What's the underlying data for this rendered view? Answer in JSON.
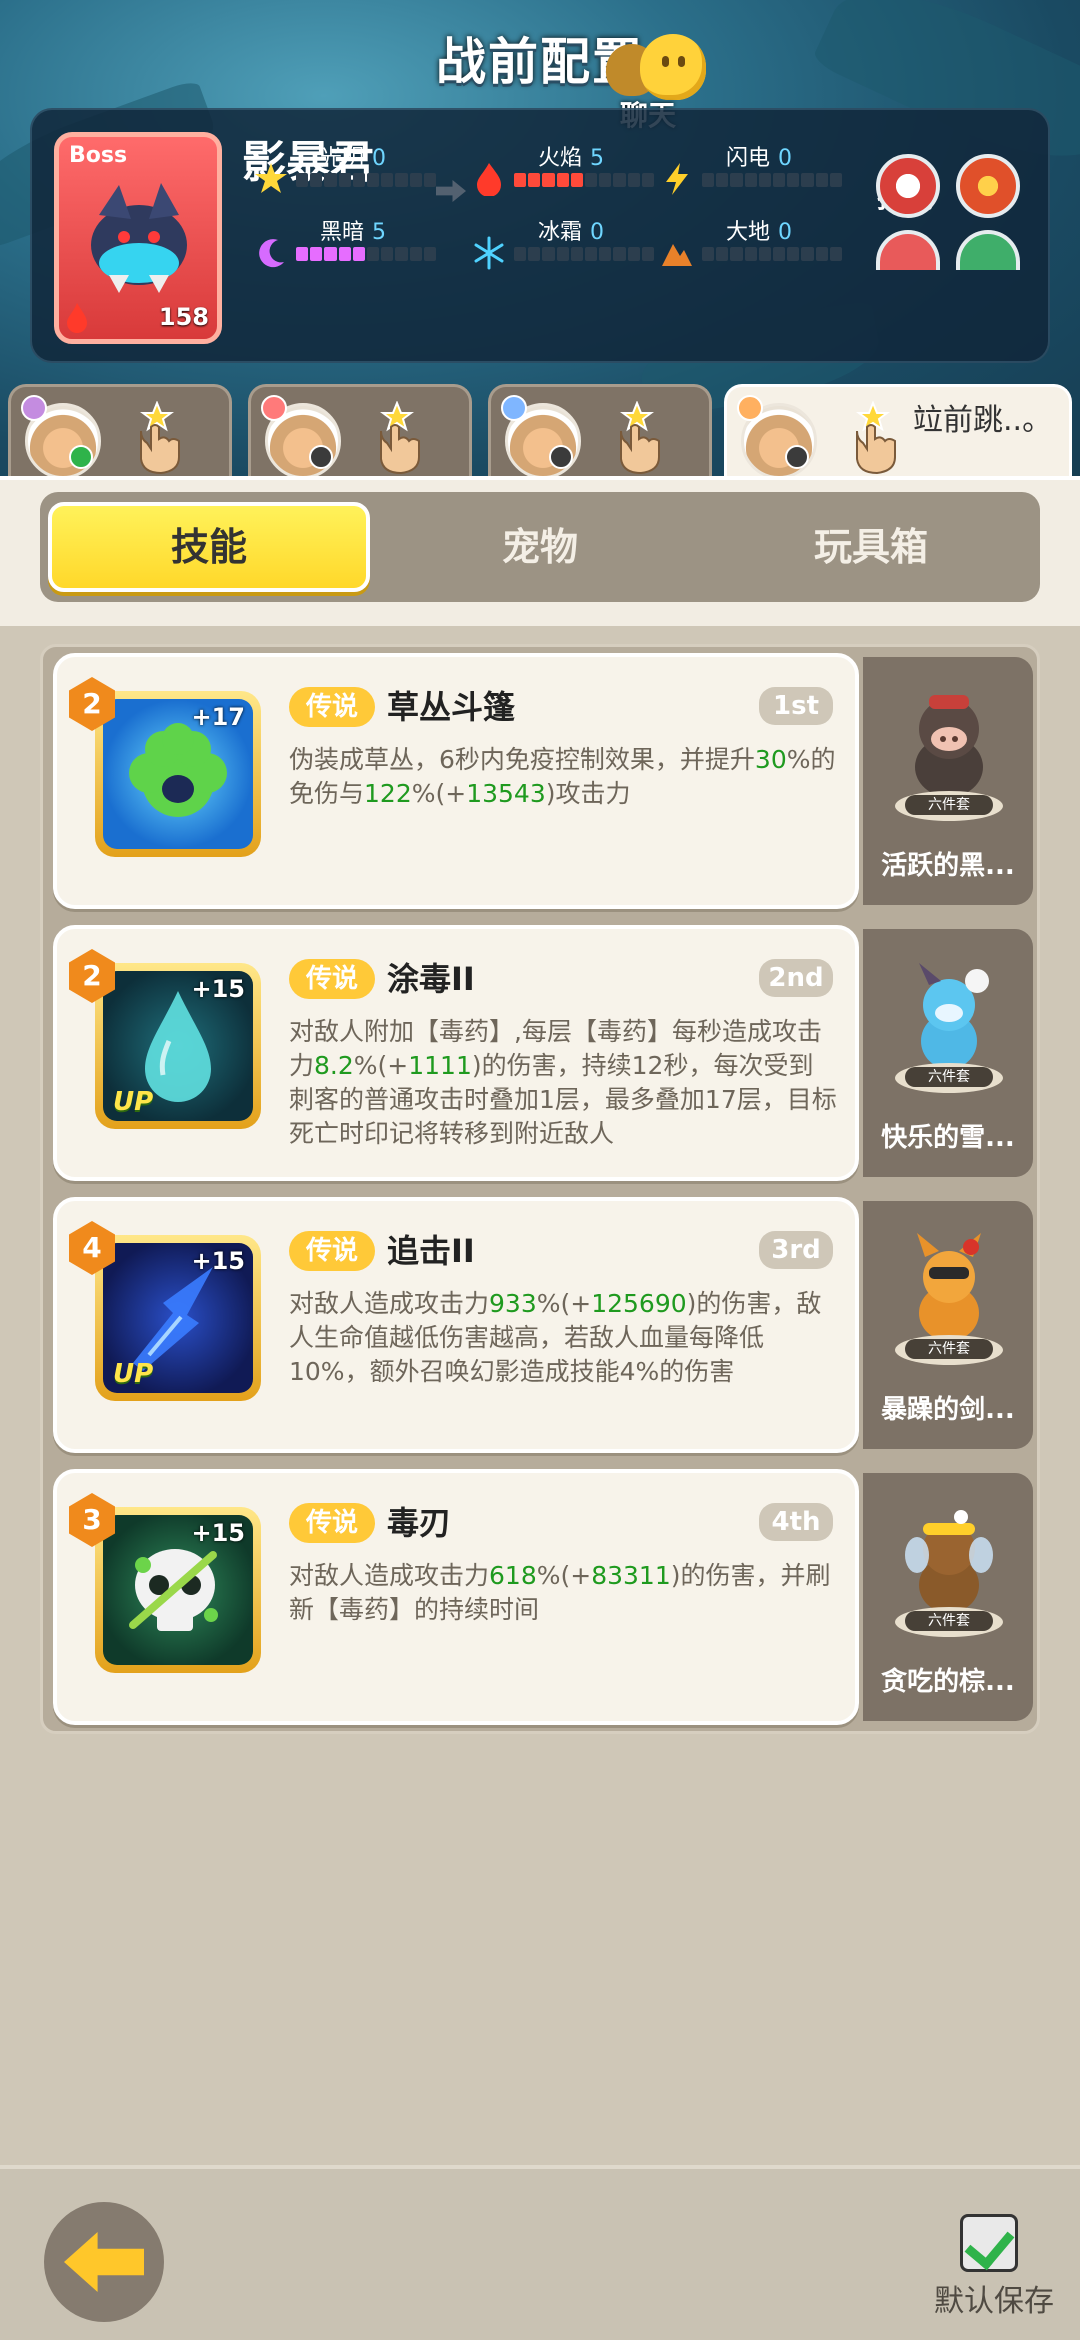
{
  "header": {
    "title": "战前配置",
    "chat_label": "聊天"
  },
  "boss": {
    "tag": "Boss",
    "name": "影暴君",
    "level": "158",
    "skills_label": "技能",
    "stats": [
      {
        "label": "光明",
        "value": "0",
        "element": "light",
        "fill": 0
      },
      {
        "label": "火焰",
        "value": "5",
        "element": "fire",
        "fill": 5
      },
      {
        "label": "闪电",
        "value": "0",
        "element": "lightning",
        "fill": 0
      },
      {
        "label": "黑暗",
        "value": "5",
        "element": "dark",
        "fill": 5
      },
      {
        "label": "冰霜",
        "value": "0",
        "element": "frost",
        "fill": 0
      },
      {
        "label": "大地",
        "value": "0",
        "element": "earth",
        "fill": 0
      }
    ]
  },
  "hero_tabs": [
    {
      "label": "",
      "active": false
    },
    {
      "label": "",
      "active": false
    },
    {
      "label": "",
      "active": false
    },
    {
      "label": "竝前跳..。",
      "active": true
    }
  ],
  "subtabs": [
    {
      "label": "技能",
      "active": true
    },
    {
      "label": "宠物",
      "active": false
    },
    {
      "label": "玩具箱",
      "active": false
    }
  ],
  "skills": [
    {
      "level": "2",
      "plus": "+17",
      "up": "",
      "tier": "传说",
      "name": "草丛斗篷",
      "rank": "1st",
      "desc_parts": [
        {
          "t": "伪装成草丛，6秒内免疫控制效果，并提升"
        },
        {
          "t": "30",
          "g": true
        },
        {
          "t": "%的免伤与"
        },
        {
          "t": "122",
          "g": true
        },
        {
          "t": "%(+"
        },
        {
          "t": "13543",
          "g": true
        },
        {
          "t": ")攻击力"
        }
      ],
      "pet_name": "活跃的黑...",
      "pet_set": "六件套"
    },
    {
      "level": "2",
      "plus": "+15",
      "up": "UP",
      "tier": "传说",
      "name": "涂毒II",
      "rank": "2nd",
      "desc_parts": [
        {
          "t": "对敌人附加【毒药】,每层【毒药】每秒造成攻击力"
        },
        {
          "t": "8.2",
          "g": true
        },
        {
          "t": "%(+"
        },
        {
          "t": "1111",
          "g": true
        },
        {
          "t": ")的伤害，持续12秒，每次受到刺客的普通攻击时叠加1层，最多叠加17层，目标死亡时印记将转移到附近敌人"
        }
      ],
      "pet_name": "快乐的雪...",
      "pet_set": "六件套"
    },
    {
      "level": "4",
      "plus": "+15",
      "up": "UP",
      "tier": "传说",
      "name": "追击II",
      "rank": "3rd",
      "desc_parts": [
        {
          "t": "对敌人造成攻击力"
        },
        {
          "t": "933",
          "g": true
        },
        {
          "t": "%(+"
        },
        {
          "t": "125690",
          "g": true
        },
        {
          "t": ")的伤害，敌人生命值越低伤害越高，若敌人血量每降低10%，额外召唤幻影造成技能4%的伤害"
        }
      ],
      "pet_name": "暴躁的剑...",
      "pet_set": "六件套"
    },
    {
      "level": "3",
      "plus": "+15",
      "up": "",
      "tier": "传说",
      "name": "毒刃",
      "rank": "4th",
      "desc_parts": [
        {
          "t": "对敌人造成攻击力"
        },
        {
          "t": "618",
          "g": true
        },
        {
          "t": "%(+"
        },
        {
          "t": "83311",
          "g": true
        },
        {
          "t": ")的伤害，并刷新【毒药】的持续时间"
        }
      ],
      "pet_name": "贪吃的棕...",
      "pet_set": "六件套"
    }
  ],
  "footer": {
    "save_label": "默认保存",
    "save_checked": true
  },
  "icons": {
    "chat": "chat-bubble-icon",
    "back": "back-arrow-icon",
    "check": "checkbox-icon",
    "hand": "tap-hand-icon"
  },
  "colors": {
    "accent_yellow": "#ffd82a",
    "green_value": "#1f9a1f",
    "tier_gold": "#ffc938"
  }
}
